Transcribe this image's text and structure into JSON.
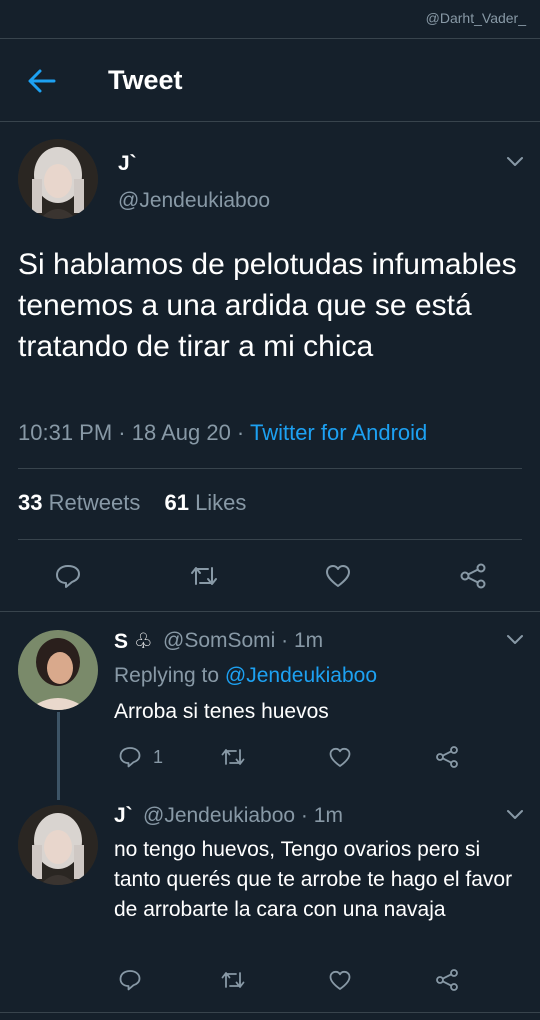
{
  "watermark": "@Darht_Vader_",
  "header": {
    "title": "Tweet"
  },
  "tweet": {
    "name": "J`",
    "handle": "@Jendeukiaboo",
    "text": "Si hablamos de pelotudas infumables tenemos a una ardida que se está tratando de tirar a mi chica",
    "time": "10:31 PM · 18 Aug 20 · ",
    "source": "Twitter for Android",
    "retweets_count": "33",
    "retweets_label": "Retweets",
    "likes_count": "61",
    "likes_label": "Likes"
  },
  "replies": [
    {
      "name": "S ♧",
      "handle_time": "@SomSomi · 1m",
      "replying_prefix": "Replying to ",
      "replying_to": "@Jendeukiaboo",
      "text": "Arroba si tenes huevos",
      "reply_count": "1"
    },
    {
      "name": "J`",
      "handle_time": "@Jendeukiaboo · 1m",
      "text": "no tengo huevos, Tengo ovarios pero si tanto querés que te arrobe te hago el favor de arrobarte la cara con una navaja"
    }
  ],
  "colors": {
    "background": "#15202b",
    "accent": "#1da1f2",
    "muted": "#8899a6",
    "divider": "#38444d"
  },
  "icons": [
    "back-arrow-icon",
    "chevron-down-icon",
    "reply-icon",
    "retweet-icon",
    "like-icon",
    "share-icon"
  ]
}
